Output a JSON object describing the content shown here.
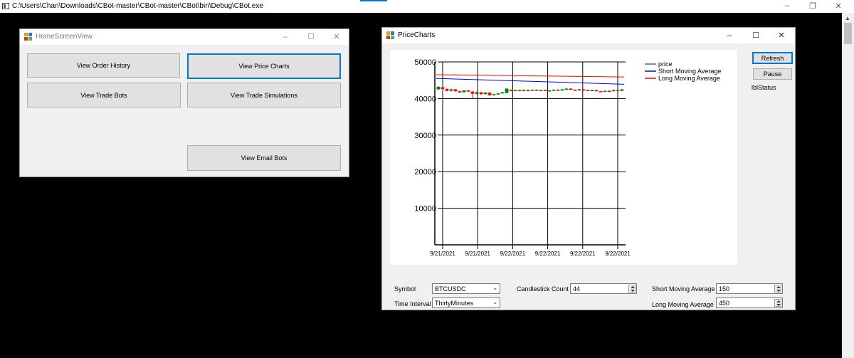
{
  "console": {
    "title": "C:\\Users\\Chan\\Downloads\\CBot-master\\CBot-master\\CBot\\bin\\Debug\\CBot.exe",
    "icon": "console-app-icon"
  },
  "home": {
    "title": "HomeScreenView",
    "buttons": {
      "order_history": "View Order History",
      "price_charts": "View Price Charts",
      "trade_bots": "View Trade Bots",
      "trade_simulations": "View Trade Simulations",
      "email_bots": "View Email Bots"
    }
  },
  "price_charts": {
    "title": "PriceCharts",
    "refresh_label": "Refresh",
    "pause_label": "Pause",
    "status_label": "lblStatus",
    "symbol_label": "Symbol",
    "symbol_value": "BTCUSDC",
    "interval_label": "Time Interval",
    "interval_value": "ThirtyMinutes",
    "candle_count_label": "Candlestick Count",
    "candle_count_value": "44",
    "short_ma_label": "Short Moving Average",
    "short_ma_value": "150",
    "long_ma_label": "Long Moving Average",
    "long_ma_value": "450"
  },
  "colors": {
    "up": "#008000",
    "down": "#ff0000",
    "price": "#1e73e8",
    "short_ma": "#0000ff",
    "long_ma": "#ff0000",
    "accent": "#0078d7"
  },
  "chart_data": {
    "type": "candlestick",
    "y_ticks": [
      10000,
      20000,
      30000,
      40000,
      50000
    ],
    "ylim": [
      0,
      50000
    ],
    "x_tick_labels": [
      "9/21/2021",
      "9/21/2021",
      "9/22/2021",
      "9/22/2021",
      "9/22/2021",
      "9/22/2021"
    ],
    "grid": true,
    "legend_position": "top-right",
    "legend": [
      {
        "name": "price",
        "color": "#1e73e8"
      },
      {
        "name": "Short Moving Average",
        "color": "#0000ff"
      },
      {
        "name": "Long Moving Average",
        "color": "#ff0000"
      }
    ],
    "candles": [
      {
        "o": 42500,
        "c": 43200,
        "h": 43400,
        "l": 42300
      },
      {
        "o": 43100,
        "c": 42600,
        "h": 43300,
        "l": 42400
      },
      {
        "o": 42600,
        "c": 42100,
        "h": 42800,
        "l": 41900
      },
      {
        "o": 42100,
        "c": 42500,
        "h": 42700,
        "l": 41900
      },
      {
        "o": 42500,
        "c": 42000,
        "h": 42600,
        "l": 41800
      },
      {
        "o": 42000,
        "c": 41700,
        "h": 42200,
        "l": 41500
      },
      {
        "o": 41700,
        "c": 42200,
        "h": 42300,
        "l": 41600
      },
      {
        "o": 42200,
        "c": 41900,
        "h": 42400,
        "l": 41800
      },
      {
        "o": 41900,
        "c": 41300,
        "h": 42000,
        "l": 39800
      },
      {
        "o": 41300,
        "c": 41700,
        "h": 41900,
        "l": 41100
      },
      {
        "o": 41700,
        "c": 41200,
        "h": 41800,
        "l": 41000
      },
      {
        "o": 41200,
        "c": 41600,
        "h": 41700,
        "l": 41100
      },
      {
        "o": 41600,
        "c": 40900,
        "h": 41700,
        "l": 40700
      },
      {
        "o": 40900,
        "c": 41200,
        "h": 41300,
        "l": 40800
      },
      {
        "o": 41200,
        "c": 41400,
        "h": 41500,
        "l": 41000
      },
      {
        "o": 41400,
        "c": 41700,
        "h": 41800,
        "l": 41300
      },
      {
        "o": 41500,
        "c": 42700,
        "h": 42800,
        "l": 41400
      },
      {
        "o": 42300,
        "c": 42100,
        "h": 42500,
        "l": 42000
      },
      {
        "o": 42100,
        "c": 42300,
        "h": 42400,
        "l": 42000
      },
      {
        "o": 42300,
        "c": 42100,
        "h": 42400,
        "l": 42000
      },
      {
        "o": 42100,
        "c": 42300,
        "h": 42500,
        "l": 42000
      },
      {
        "o": 42300,
        "c": 42200,
        "h": 42400,
        "l": 42100
      },
      {
        "o": 42200,
        "c": 42400,
        "h": 42500,
        "l": 42100
      },
      {
        "o": 42400,
        "c": 42200,
        "h": 42500,
        "l": 42100
      },
      {
        "o": 42200,
        "c": 42300,
        "h": 42400,
        "l": 42100
      },
      {
        "o": 42300,
        "c": 42100,
        "h": 42400,
        "l": 42000
      },
      {
        "o": 42100,
        "c": 42200,
        "h": 42300,
        "l": 42000
      },
      {
        "o": 42200,
        "c": 42400,
        "h": 42500,
        "l": 42100
      },
      {
        "o": 42400,
        "c": 42200,
        "h": 42500,
        "l": 42100
      },
      {
        "o": 42200,
        "c": 42500,
        "h": 42600,
        "l": 42100
      },
      {
        "o": 42500,
        "c": 42700,
        "h": 42900,
        "l": 42400
      },
      {
        "o": 42700,
        "c": 42400,
        "h": 42800,
        "l": 42300
      },
      {
        "o": 42400,
        "c": 42300,
        "h": 42500,
        "l": 42200
      },
      {
        "o": 42300,
        "c": 42500,
        "h": 42600,
        "l": 42200
      },
      {
        "o": 42500,
        "c": 42300,
        "h": 42600,
        "l": 42200
      },
      {
        "o": 42300,
        "c": 42100,
        "h": 42400,
        "l": 42000
      },
      {
        "o": 42100,
        "c": 42300,
        "h": 42400,
        "l": 42000
      },
      {
        "o": 42300,
        "c": 42000,
        "h": 42400,
        "l": 41900
      },
      {
        "o": 42000,
        "c": 41900,
        "h": 42100,
        "l": 41800
      },
      {
        "o": 41900,
        "c": 42100,
        "h": 42200,
        "l": 41800
      },
      {
        "o": 42100,
        "c": 42000,
        "h": 42200,
        "l": 41900
      },
      {
        "o": 42000,
        "c": 42300,
        "h": 42400,
        "l": 41900
      },
      {
        "o": 42300,
        "c": 42100,
        "h": 42400,
        "l": 42000
      },
      {
        "o": 42100,
        "c": 42500,
        "h": 42600,
        "l": 42000
      }
    ],
    "short_moving_average": {
      "start": 45500,
      "end": 43900
    },
    "long_moving_average": {
      "start": 46500,
      "end": 45900
    }
  }
}
